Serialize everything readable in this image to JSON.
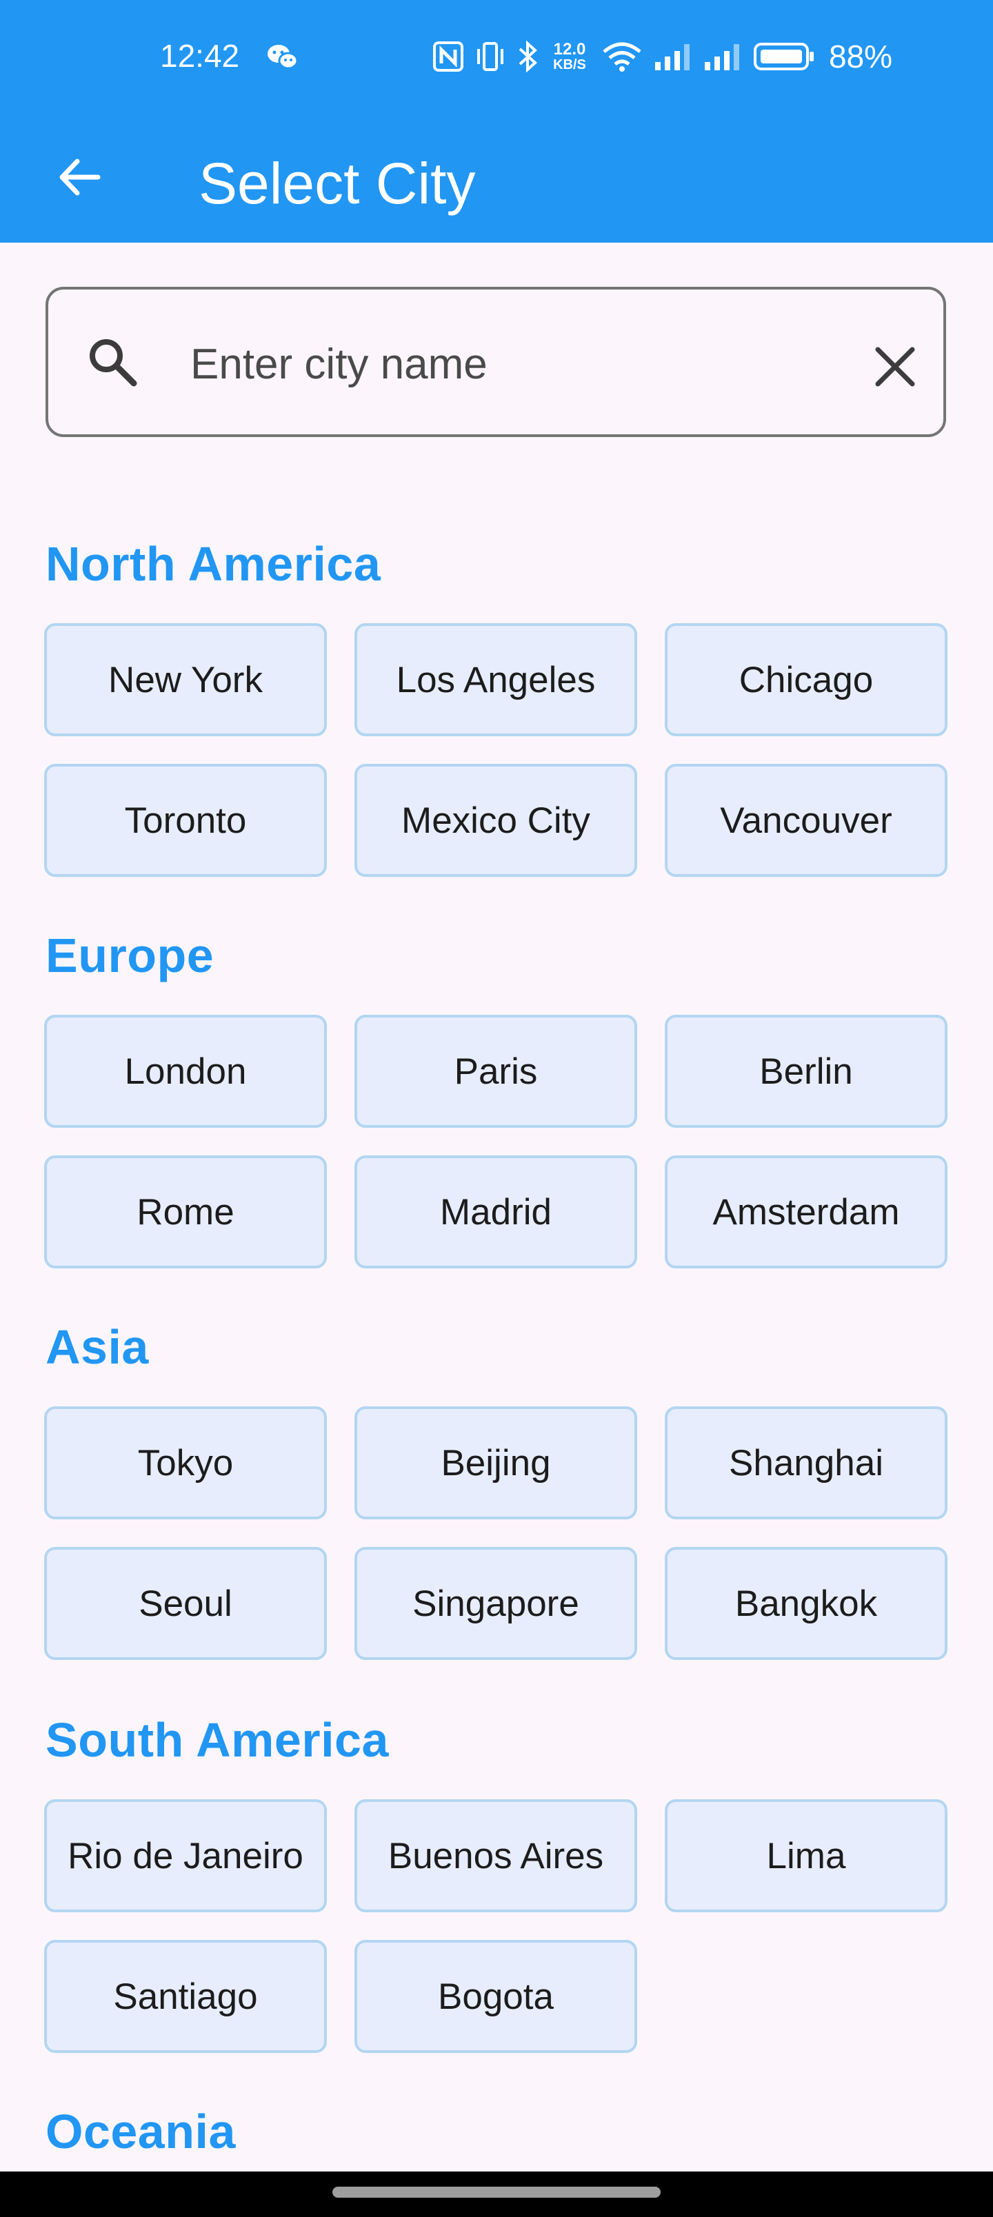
{
  "status_bar": {
    "time": "12:42",
    "network_speed_value": "12.0",
    "network_speed_unit": "KB/S",
    "battery_percent": "88%",
    "icons": [
      "wechat-icon",
      "nfc-icon",
      "vibrate-icon",
      "bluetooth-icon",
      "wifi-icon",
      "signal-icon",
      "signal-icon",
      "battery-icon"
    ]
  },
  "app_bar": {
    "title": "Select City",
    "back_icon": "arrow-left-icon"
  },
  "search": {
    "placeholder": "Enter city name",
    "value": "",
    "search_icon": "search-icon",
    "clear_icon": "close-icon"
  },
  "regions": [
    {
      "name": "North America",
      "cities": [
        "New York",
        "Los Angeles",
        "Chicago",
        "Toronto",
        "Mexico City",
        "Vancouver"
      ]
    },
    {
      "name": "Europe",
      "cities": [
        "London",
        "Paris",
        "Berlin",
        "Rome",
        "Madrid",
        "Amsterdam"
      ]
    },
    {
      "name": "Asia",
      "cities": [
        "Tokyo",
        "Beijing",
        "Shanghai",
        "Seoul",
        "Singapore",
        "Bangkok"
      ]
    },
    {
      "name": "South America",
      "cities": [
        "Rio de Janeiro",
        "Buenos Aires",
        "Lima",
        "Santiago",
        "Bogota"
      ]
    },
    {
      "name": "Oceania",
      "cities": []
    }
  ],
  "colors": {
    "primary": "#2196f3",
    "background": "#fcf6fc",
    "chip_fill": "#e7edfd",
    "chip_border": "#b3d6f1"
  }
}
